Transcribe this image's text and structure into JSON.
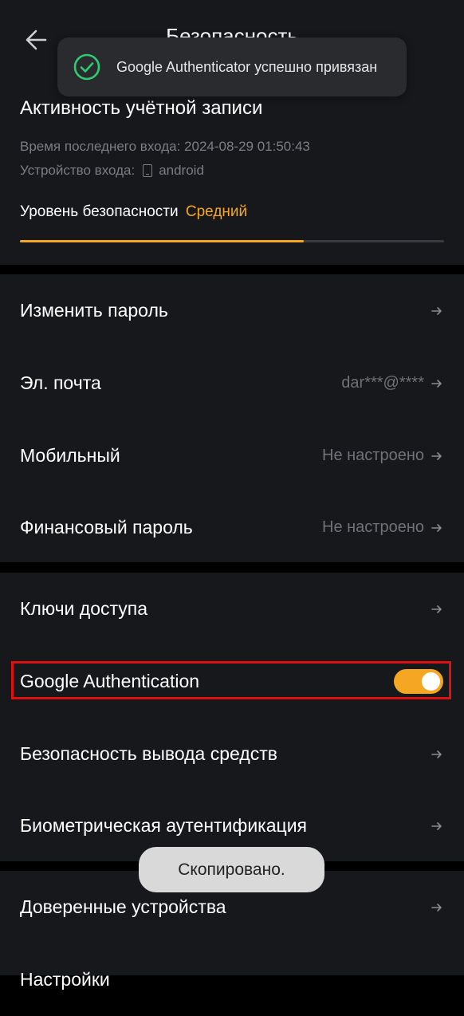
{
  "header": {
    "title": "Безопасность"
  },
  "toast_top": {
    "message": "Google Authenticator успешно привязан"
  },
  "account": {
    "title": "Активность учётной записи",
    "last_login": "Время последнего входа: 2024-08-29 01:50:43",
    "device_label": "Устройство входа:",
    "device_value": "android",
    "security_level_label": "Уровень безопасности",
    "security_level_value": "Средний",
    "security_level_progress": 0.67
  },
  "section1": {
    "items": [
      {
        "label": "Изменить пароль",
        "value": ""
      },
      {
        "label": "Эл. почта",
        "value": "dar***@****"
      },
      {
        "label": "Мобильный",
        "value": "Не настроено"
      },
      {
        "label": "Финансовый пароль",
        "value": "Не настроено"
      }
    ]
  },
  "section2": {
    "items": [
      {
        "label": "Ключи доступа"
      },
      {
        "label": "Google Authentication",
        "toggle": true
      },
      {
        "label": "Безопасность вывода средств"
      },
      {
        "label": "Биометрическая аутентификация"
      }
    ]
  },
  "section3": {
    "items": [
      {
        "label": "Доверенные устройства"
      },
      {
        "label": "Настройки"
      }
    ]
  },
  "toast_bottom": {
    "message": "Скопировано."
  },
  "colors": {
    "accent": "#f5a623",
    "highlight": "#e01010",
    "background": "#17181c"
  }
}
